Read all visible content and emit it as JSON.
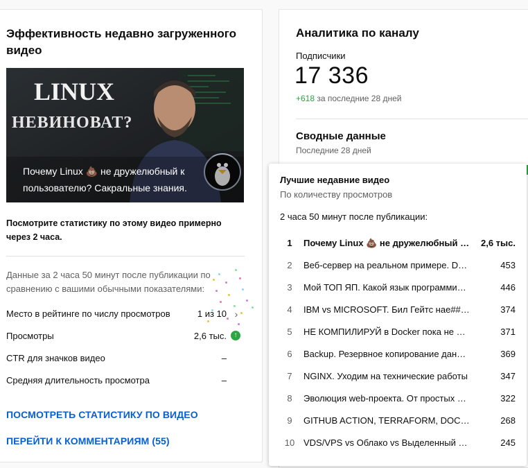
{
  "left_card": {
    "title": "Эффективность недавно загруженного видео",
    "thumbnail": {
      "text_line1": "LINUX",
      "text_line2": "НЕВИНОВАТ?",
      "caption": "Почему Linux 💩 не дружелюбный к пользователю? Сакральные знания."
    },
    "hint": "Посмотрите статистику по этому видео примерно через 2 часа.",
    "range_note": "Данные за 2 часа 50 минут после публикации по сравнению с вашими обычными показателями:",
    "stats": [
      {
        "label": "Место в рейтинге по числу просмотров",
        "value": "1 из 10",
        "extra": "chevron-right-icon"
      },
      {
        "label": "Просмотры",
        "value": "2,6 тыс.",
        "extra": "arrow-up-icon"
      },
      {
        "label": "CTR для значков видео",
        "value": "–",
        "extra": ""
      },
      {
        "label": "Средняя длительность просмотра",
        "value": "–",
        "extra": ""
      }
    ],
    "link_stats": "ПОСМОТРЕТЬ СТАТИСТИКУ ПО ВИДЕО",
    "link_comments": "ПЕРЕЙТИ К КОММЕНТАРИЯМ (55)"
  },
  "right_card": {
    "title": "Аналитика по каналу",
    "subscribers_label": "Подписчики",
    "subscribers_value": "17 336",
    "subscribers_delta": "+618",
    "subscribers_delta_suffix": "за последние 28 дней",
    "summary_title": "Сводные данные",
    "summary_sub": "Последние 28 дней"
  },
  "popup": {
    "title": "Лучшие недавние видео",
    "subtitle": "По количеству просмотров",
    "note": "2 часа 50 минут после публикации:",
    "rows": [
      {
        "rank": "1",
        "title": "Почему Linux 💩 не дружелюбный к пользователю?",
        "views": "2,6 тыс."
      },
      {
        "rank": "2",
        "title": "Веб-сервер на реальном примере. Docker",
        "views": "453"
      },
      {
        "rank": "3",
        "title": "Мой ТОП ЯП. Какой язык программирования",
        "views": "446"
      },
      {
        "rank": "4",
        "title": "IBM vs MICROSOFT. Бил Гейтс нае### всех",
        "views": "374"
      },
      {
        "rank": "5",
        "title": "НЕ КОМПИЛИРУЙ в Docker пока не посмотришь",
        "views": "371"
      },
      {
        "rank": "6",
        "title": "Backup. Резервное копирование данных",
        "views": "369"
      },
      {
        "rank": "7",
        "title": "NGINX. Уходим на технические работы",
        "views": "347"
      },
      {
        "rank": "8",
        "title": "Эволюция web-проекта. От простых сайтов",
        "views": "322"
      },
      {
        "rank": "9",
        "title": "GITHUB ACTION, TERRAFORM, DOCKER, ANSIBLE",
        "views": "268"
      },
      {
        "rank": "10",
        "title": "VDS/VPS vs Облако vs Выделенный Сервер",
        "views": "245"
      }
    ]
  },
  "colors": {
    "link": "#065fd4",
    "positive": "#2ba640",
    "secondary_text": "#606060"
  }
}
